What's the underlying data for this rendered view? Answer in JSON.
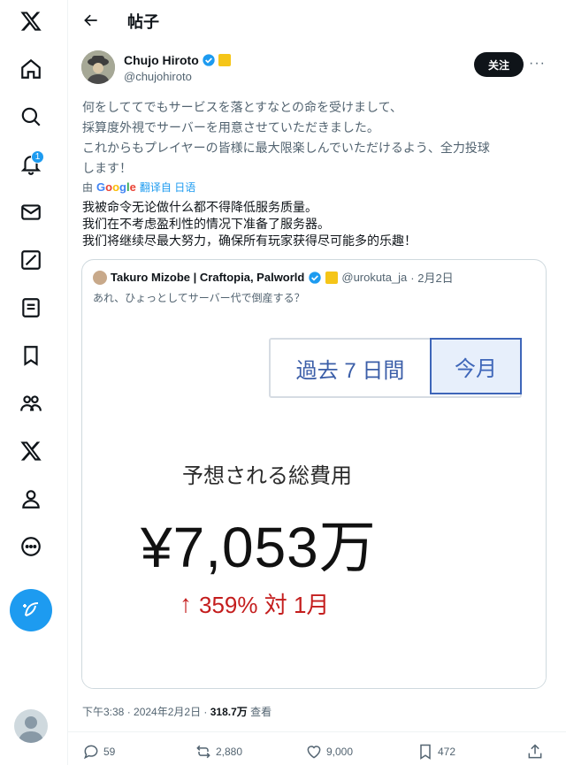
{
  "nav": {
    "notifications_badge": "1",
    "items": [
      "x-logo",
      "home",
      "explore",
      "notifications",
      "messages",
      "grok",
      "lists",
      "bookmarks",
      "communities",
      "premium",
      "profile",
      "more"
    ]
  },
  "header": {
    "title": "帖子"
  },
  "post": {
    "author_name": "Chujo Hiroto",
    "handle": "@chujohiroto",
    "follow_label": "关注",
    "more_label": "···",
    "original_lines": [
      "何をしててでもサービスを落とすなとの命を受けまして、",
      "採算度外視でサーバーを用意させていただきました。",
      "これからもプレイヤーの皆様に最大限楽しんでいただけるよう、全力投球",
      "します！"
    ],
    "translate_by": "由",
    "translate_link": "翻译自 日语",
    "translated_lines": [
      "我被命令无论做什么都不得降低服务质量。",
      "我们在不考虑盈利性的情况下准备了服务器。",
      "我们将继续尽最大努力，确保所有玩家获得尽可能多的乐趣！"
    ],
    "timestamp": "下午3:38 · 2024年2月2日 · ",
    "views": "318.7万",
    "views_label": " 查看",
    "stats": {
      "replies": "59",
      "reposts": "2,880",
      "likes": "9,000",
      "bookmarks": "472"
    }
  },
  "quote": {
    "author_name": "Takuro Mizobe | Craftopia, Palworld",
    "handle": "@urokuta_ja",
    "date": "· 2月2日",
    "text": "あれ、ひょっとしてサーバー代で倒産する？",
    "media": {
      "tab_past": "過去 7 日間",
      "tab_month": "今月",
      "label": "予想される総費用",
      "value": "¥7,053万",
      "change": "359% 対 1月",
      "change_arrow": "↑"
    }
  },
  "colors": {
    "accent": "#1d9bf0",
    "media_blue": "#3e66b9",
    "media_red": "#c41d1d"
  }
}
